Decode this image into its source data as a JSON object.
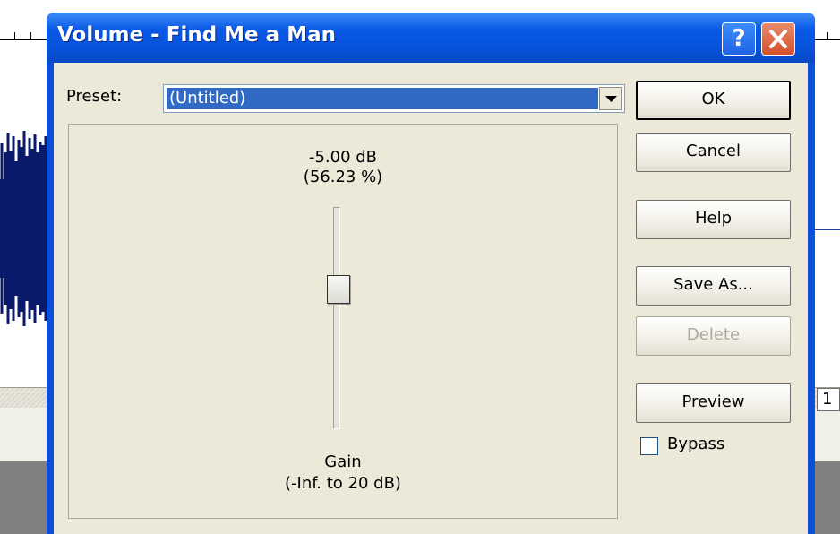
{
  "dialog": {
    "title": "Volume - Find Me a Man",
    "help_glyph": "?",
    "preset_label": "Preset:",
    "preset_value": "(Untitled)",
    "gain": {
      "db_text": "-5.00 dB",
      "percent_text": "(56.23 %)",
      "label": "Gain",
      "range_text": "(-Inf. to 20 dB)",
      "slider_level_db": -5.0
    },
    "buttons": {
      "ok": "OK",
      "cancel": "Cancel",
      "help": "Help",
      "save_as": "Save As...",
      "delete": "Delete",
      "preview": "Preview"
    },
    "bypass_label": "Bypass",
    "bypass_checked": false
  },
  "background": {
    "side_box_text": "1"
  },
  "colors": {
    "titlebar": "#0a4fd8",
    "selection": "#316ac5",
    "dialog_face": "#ece9d8",
    "close_button": "#d4502c",
    "waveform": "#0a1a6a"
  },
  "icons": [
    "help-icon",
    "close-icon",
    "chevron-down-icon"
  ]
}
